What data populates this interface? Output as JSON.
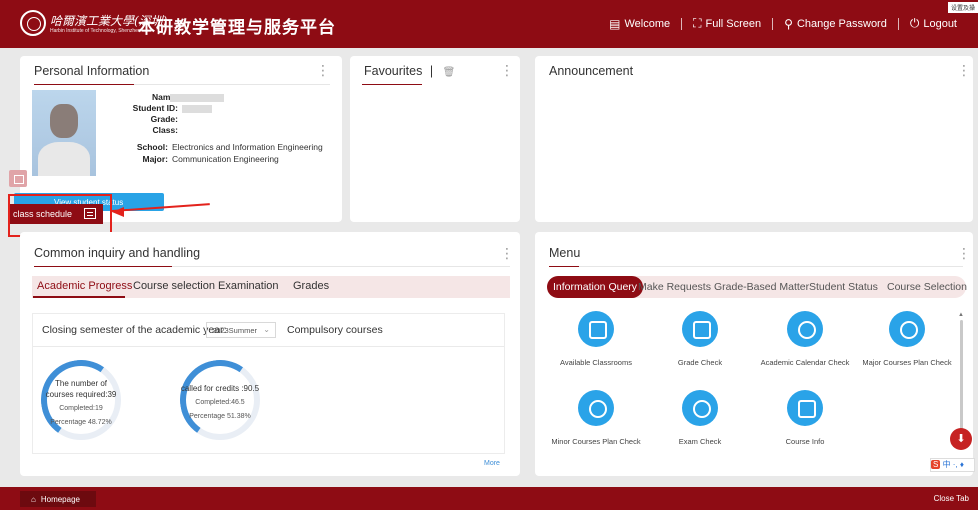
{
  "header": {
    "university_name": "哈爾濱工業大學(深圳)",
    "university_subtitle": "Harbin Institute of Technology, Shenzhen",
    "system_title": "本研教学管理与服务平台",
    "nav": {
      "welcome": "Welcome",
      "full_screen": "Full Screen",
      "change_password": "Change Password",
      "logout": "Logout"
    },
    "corner_tag": "设置及操"
  },
  "personal": {
    "title": "Personal Information",
    "labels": {
      "name": "Name:",
      "student_id": "Student ID:",
      "grade": "Grade:",
      "class": "Class:",
      "school": "School:",
      "major": "Major:"
    },
    "values": {
      "school": "Electronics and Information Engineering",
      "major": "Communication Engineering"
    },
    "status_button": "View student status information",
    "schedule_tag": "class schedule"
  },
  "favourites": {
    "title": "Favourites"
  },
  "announcement": {
    "title": "Announcement"
  },
  "inquiry": {
    "title": "Common inquiry and handling",
    "tabs": [
      "Academic Progress",
      "Course selection",
      "Examination",
      "Grades"
    ],
    "semester_label": "Closing semester of the academic year:",
    "semester_value": "2023Summer",
    "compulsory_label": "Compulsory courses",
    "ring1": {
      "line1": "The number of",
      "line2": "courses required:39",
      "line3": "Completed:19",
      "line4": "Percentage 48.72%"
    },
    "ring2": {
      "line1": "called for credits :90.5",
      "line2": "Completed:46.5",
      "line3": "Percentage 51.38%"
    },
    "more": "More",
    "progress_fractions": [
      0.4872,
      0.5138
    ],
    "accent": "#3f8fd7"
  },
  "menu": {
    "title": "Menu",
    "tabs": [
      "Information Query",
      "Make Requests",
      "Grade-Based Matter",
      "Student Status",
      "Course Selection"
    ],
    "items": [
      {
        "label": "Available Classrooms",
        "icon": "classroom-icon"
      },
      {
        "label": "Grade Check",
        "icon": "grade-check-icon"
      },
      {
        "label": "Academic Calendar Check",
        "icon": "calendar-icon"
      },
      {
        "label": "Major Courses Plan Check",
        "icon": "plan-check-icon"
      },
      {
        "label": "Minor Courses Plan Check",
        "icon": "plan-check-icon"
      },
      {
        "label": "Exam Check",
        "icon": "exam-check-icon"
      },
      {
        "label": "Course Info",
        "icon": "course-info-icon"
      }
    ]
  },
  "ime": {
    "s": "S",
    "text": "中 ·, ♦"
  },
  "bottom": {
    "tab": "Homepage",
    "close": "Close Tab"
  },
  "colors": {
    "brand": "#8e0c14",
    "accent_blue": "#2aa3e8",
    "annotation_red": "#e3221c"
  }
}
